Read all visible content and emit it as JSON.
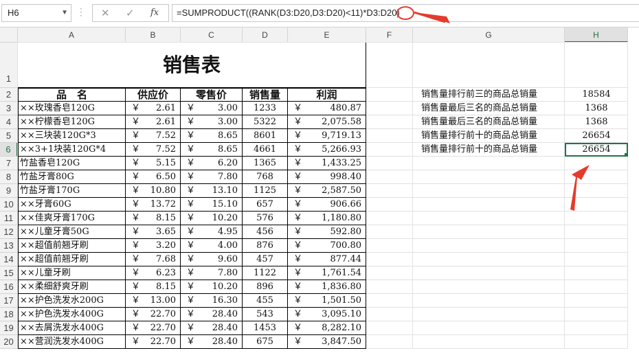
{
  "formula_bar": {
    "name_box": "H6",
    "cancel_icon": "✕",
    "enter_icon": "✓",
    "fx_icon": "fx",
    "formula": "=SUMPRODUCT((RANK(D3:D20,D3:D20)<11)*D3:D20)"
  },
  "columns": [
    "A",
    "B",
    "C",
    "D",
    "E",
    "F",
    "G",
    "H"
  ],
  "rows": [
    "1",
    "2",
    "3",
    "4",
    "5",
    "6",
    "7",
    "8",
    "9",
    "10",
    "11",
    "12",
    "13",
    "14",
    "15",
    "16",
    "17",
    "18",
    "19",
    "20"
  ],
  "sheet": {
    "title": "销售表",
    "headers": [
      "品　名",
      "供应价",
      "零售价",
      "销售量",
      "利润"
    ],
    "currency": "￥",
    "items": [
      {
        "name": "××玫瑰香皂120G",
        "supply": "2.61",
        "retail": "3.00",
        "qty": "1233",
        "profit": "480.87"
      },
      {
        "name": "××柠檬香皂120G",
        "supply": "2.61",
        "retail": "3.00",
        "qty": "5322",
        "profit": "2,075.58"
      },
      {
        "name": "××三块装120G*3",
        "supply": "7.52",
        "retail": "8.65",
        "qty": "8601",
        "profit": "9,719.13"
      },
      {
        "name": "××3+1块装120G*4",
        "supply": "7.52",
        "retail": "8.65",
        "qty": "4661",
        "profit": "5,266.93"
      },
      {
        "name": "竹盐香皂120G",
        "supply": "5.15",
        "retail": "6.20",
        "qty": "1365",
        "profit": "1,433.25"
      },
      {
        "name": "竹盐牙膏80G",
        "supply": "6.50",
        "retail": "7.80",
        "qty": "768",
        "profit": "998.40"
      },
      {
        "name": "竹盐牙膏170G",
        "supply": "10.80",
        "retail": "13.10",
        "qty": "1125",
        "profit": "2,587.50"
      },
      {
        "name": "××牙膏60G",
        "supply": "13.72",
        "retail": "15.10",
        "qty": "657",
        "profit": "906.66"
      },
      {
        "name": "××佳爽牙膏170G",
        "supply": "8.15",
        "retail": "10.20",
        "qty": "576",
        "profit": "1,180.80"
      },
      {
        "name": "××儿童牙膏50G",
        "supply": "3.65",
        "retail": "4.95",
        "qty": "456",
        "profit": "592.80"
      },
      {
        "name": "××超值前翘牙刷",
        "supply": "3.20",
        "retail": "4.00",
        "qty": "876",
        "profit": "700.80"
      },
      {
        "name": "××超值前翘牙刷",
        "supply": "7.68",
        "retail": "9.60",
        "qty": "457",
        "profit": "877.44"
      },
      {
        "name": "××儿童牙刷",
        "supply": "6.23",
        "retail": "7.80",
        "qty": "1122",
        "profit": "1,761.54"
      },
      {
        "name": "××柔细舒爽牙刷",
        "supply": "8.15",
        "retail": "10.20",
        "qty": "896",
        "profit": "1,836.80"
      },
      {
        "name": "××护色洗发水200G",
        "supply": "13.00",
        "retail": "16.30",
        "qty": "455",
        "profit": "1,501.50"
      },
      {
        "name": "××护色洗发水400G",
        "supply": "22.70",
        "retail": "28.40",
        "qty": "543",
        "profit": "3,095.10"
      },
      {
        "name": "××去屑洗发水400G",
        "supply": "22.70",
        "retail": "28.40",
        "qty": "1453",
        "profit": "8,282.10"
      },
      {
        "name": "××营润洗发水400G",
        "supply": "22.70",
        "retail": "28.40",
        "qty": "675",
        "profit": "3,847.50"
      }
    ]
  },
  "summary": [
    {
      "label": "销售量排行前三的商品总销量",
      "value": "18584"
    },
    {
      "label": "销售量最后三名的商品总销量",
      "value": "1368"
    },
    {
      "label": "销售量最后三名的商品总销量",
      "value": "1368"
    },
    {
      "label": "销售量排行前十的商品总销量",
      "value": "26654"
    },
    {
      "label": "销售量排行前十的商品总销量",
      "value": "26654"
    }
  ],
  "colors": {
    "accent": "#217346",
    "annotation": "#e53b2d"
  }
}
